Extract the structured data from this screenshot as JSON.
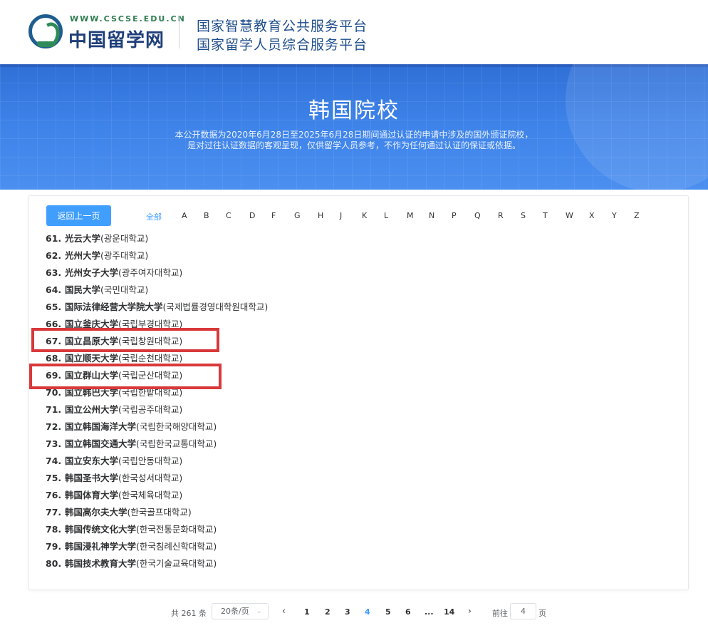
{
  "header": {
    "site_url": "WWW.CSCSE.EDU.CN",
    "site_name": "中国留学网",
    "title_line1": "国家智慧教育公共服务平台",
    "title_line2": "国家留学人员综合服务平台"
  },
  "banner": {
    "title": "韩国院校",
    "desc_line1": "本公开数据为2020年6月28日至2025年6月28日期间通过认证的申请中涉及的国外颁证院校，",
    "desc_line2": "是对过往认证数据的客观呈现，仅供留学人员参考，不作为任何通过认证的保证或依据。"
  },
  "filter": {
    "back_label": "返回上一页",
    "all_label": "全部",
    "letters": [
      "A",
      "B",
      "C",
      "D",
      "F",
      "G",
      "H",
      "J",
      "K",
      "L",
      "M",
      "N",
      "P",
      "Q",
      "R",
      "S",
      "T",
      "W",
      "X",
      "Y",
      "Z"
    ]
  },
  "schools": [
    {
      "num": "61.",
      "cn": "光云大学",
      "kr": "(광운대학교)"
    },
    {
      "num": "62.",
      "cn": "光州大学",
      "kr": "(광주대학교)"
    },
    {
      "num": "63.",
      "cn": "光州女子大学",
      "kr": "(광주여자대학교)"
    },
    {
      "num": "64.",
      "cn": "国民大学",
      "kr": "(국민대학교)"
    },
    {
      "num": "65.",
      "cn": "国际法律经营大学院大学",
      "kr": "(국제법률경영대학원대학교)"
    },
    {
      "num": "66.",
      "cn": "国立釜庆大学",
      "kr": "(국립부경대학교)"
    },
    {
      "num": "67.",
      "cn": "国立昌原大学",
      "kr": "(국립창원대학교)"
    },
    {
      "num": "68.",
      "cn": "国立顺天大学",
      "kr": "(국립순천대학교)"
    },
    {
      "num": "69.",
      "cn": "国立群山大学",
      "kr": "(국립군산대학교)"
    },
    {
      "num": "70.",
      "cn": "国立韩巴大学",
      "kr": "(국립한밭대학교)"
    },
    {
      "num": "71.",
      "cn": "国立公州大学",
      "kr": "(국립공주대학교)"
    },
    {
      "num": "72.",
      "cn": "国立韩国海洋大学",
      "kr": "(국립한국해양대학교)"
    },
    {
      "num": "73.",
      "cn": "国立韩国交通大学",
      "kr": "(국립한국교통대학교)"
    },
    {
      "num": "74.",
      "cn": "国立安东大学",
      "kr": "(국립안동대학교)"
    },
    {
      "num": "75.",
      "cn": "韩国圣书大学",
      "kr": "(한국성서대학교)"
    },
    {
      "num": "76.",
      "cn": "韩国体育大学",
      "kr": "(한국체육대학교)"
    },
    {
      "num": "77.",
      "cn": "韩国高尔夫大学",
      "kr": "(한국골프대학교)"
    },
    {
      "num": "78.",
      "cn": "韩国传统文化大学",
      "kr": "(한국전통문화대학교)"
    },
    {
      "num": "79.",
      "cn": "韩国浸礼神学大学",
      "kr": "(한국침례신학대학교)"
    },
    {
      "num": "80.",
      "cn": "韩国技术教育大学",
      "kr": "(한국기술교육대학교)"
    }
  ],
  "highlight_color": "#d9383a",
  "accent_color": "#409eff",
  "pagination": {
    "total": "共 261 条",
    "page_size": "20条/页",
    "prev_icon": "chevron-left-icon",
    "next_icon": "chevron-right-icon",
    "pages": [
      "1",
      "2",
      "3",
      "4",
      "5",
      "6",
      "...",
      "14"
    ],
    "current_page": "4",
    "goto_label": "前往",
    "goto_value": "4",
    "page_suffix": "页"
  }
}
